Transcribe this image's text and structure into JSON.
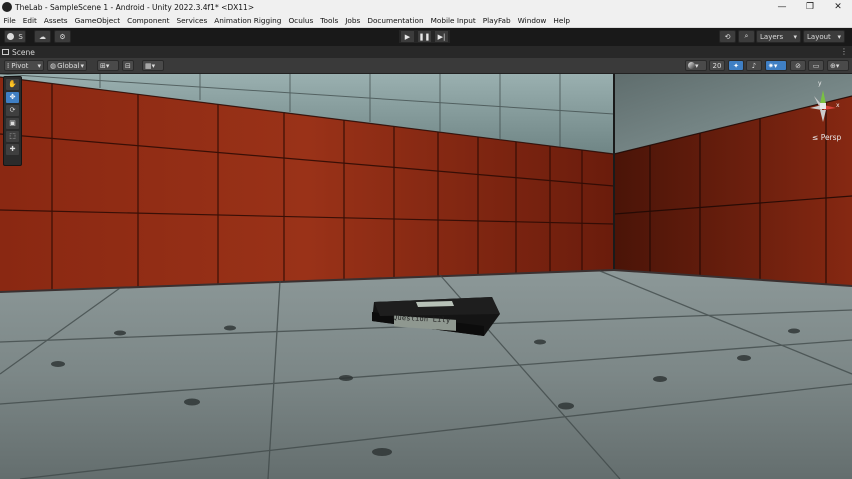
{
  "window": {
    "title": "TheLab - SampleScene 1 - Android - Unity 2022.3.4f1* <DX11>",
    "controls": [
      "—",
      "❐",
      "✕"
    ]
  },
  "menu": [
    "File",
    "Edit",
    "Assets",
    "GameObject",
    "Component",
    "Services",
    "Animation Rigging",
    "Oculus",
    "Tools",
    "Jobs",
    "Documentation",
    "Mobile Input",
    "PlayFab",
    "Window",
    "Help"
  ],
  "toolbar": {
    "account_label": "S",
    "layers_label": "Layers",
    "layout_label": "Layout",
    "play_glyph": "▶",
    "pause_glyph": "❚❚",
    "step_glyph": "▶|",
    "history_glyph": "⟲",
    "search_glyph": "⌕",
    "cloud_glyph": "☁",
    "gear_glyph": "⚙",
    "dropdown_glyph": "▾"
  },
  "scene_tab": {
    "label": "Scene",
    "pivot_label": "Pivot",
    "global_label": "Global",
    "camera_speed": "20",
    "persp_label": "Persp",
    "gizmo_axes": {
      "y": "y",
      "x": "x"
    }
  },
  "tool_icons": [
    "✋",
    "✥",
    "⟳",
    "▣",
    "⬚",
    "✚"
  ],
  "cassette_label": "Question Lily",
  "colors": {
    "titlebar": "#f0f0f0",
    "editor_bg": "#191919",
    "wall_red": "#8e2a14",
    "floor": "#7f8a89",
    "accent_blue": "#3f7fc4"
  }
}
